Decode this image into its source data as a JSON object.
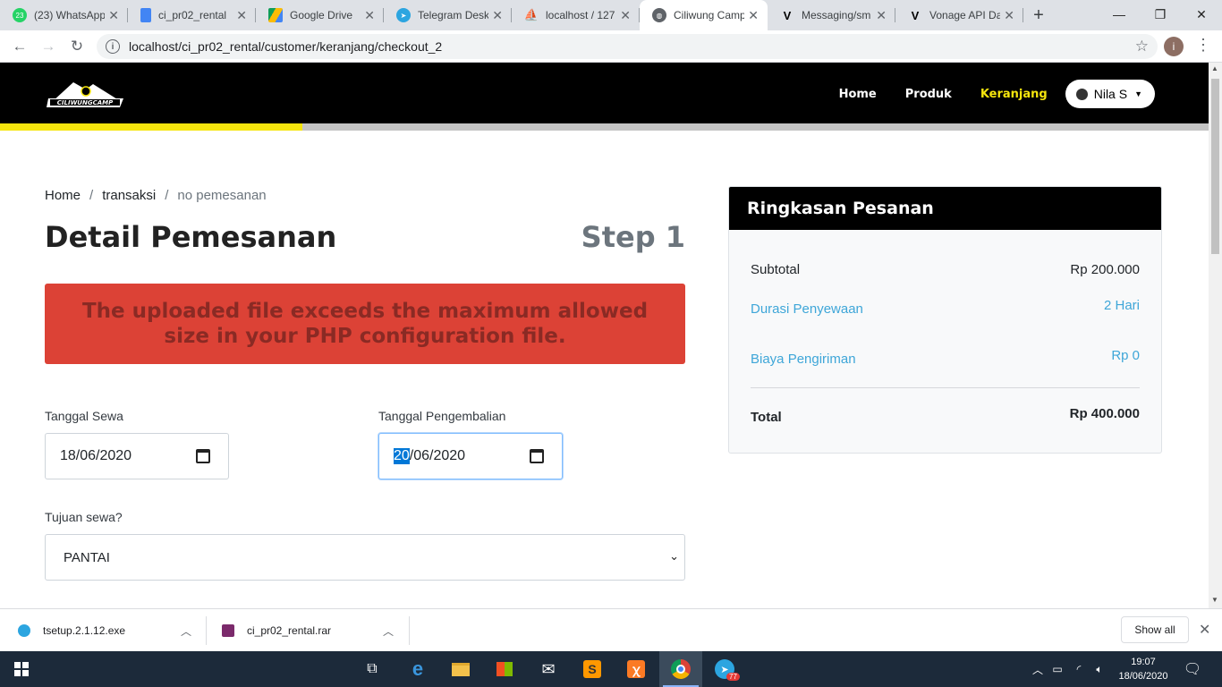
{
  "browser": {
    "tabs": [
      {
        "title": "(23) WhatsApp",
        "badge": "23",
        "favicon": "whatsapp-icon",
        "color": "#25d366"
      },
      {
        "title": "ci_pr02_rental",
        "favicon": "docs-icon",
        "color": "#4285f4"
      },
      {
        "title": "Google Drive",
        "favicon": "drive-icon",
        "color": "#fbbc04"
      },
      {
        "title": "Telegram Desk",
        "favicon": "telegram-icon",
        "color": "#2ca5e0"
      },
      {
        "title": "localhost / 127",
        "favicon": "phpmyadmin-icon",
        "color": "#f89c0e"
      },
      {
        "title": "Ciliwung Camp",
        "favicon": "globe-icon",
        "color": "#5f6368",
        "active": true
      },
      {
        "title": "Messaging/sm",
        "favicon": "vonage-icon",
        "color": "#000000"
      },
      {
        "title": "Vonage API Da",
        "favicon": "vonage-icon",
        "color": "#000000"
      }
    ],
    "url": "localhost/ci_pr02_rental/customer/keranjang/checkout_2",
    "profile_initial": "i"
  },
  "site": {
    "brand": "CILIWUNGCAMP",
    "nav": {
      "home": "Home",
      "produk": "Produk",
      "keranjang": "Keranjang"
    },
    "user": "Nila S",
    "progress_fraction": 0.25
  },
  "page": {
    "breadcrumb": [
      "Home",
      "transaksi",
      "no pemesanan"
    ],
    "breadcrumb_sep": "/",
    "title": "Detail Pemesanan",
    "step": "Step 1",
    "alert": "The uploaded file exceeds the maximum allowed size in your PHP configuration file."
  },
  "form": {
    "start_label": "Tanggal Sewa",
    "start_date": "18/06/2020",
    "end_label": "Tanggal Pengembalian",
    "end_day": "20",
    "end_rest": "/06/2020",
    "purpose_label": "Tujuan sewa?",
    "purpose_value": "PANTAI"
  },
  "summary": {
    "title": "Ringkasan Pesanan",
    "subtotal_label": "Subtotal",
    "subtotal_value": "Rp 200.000",
    "duration_label": "Durasi Penyewaan",
    "duration_value": "2 Hari",
    "shipping_label": "Biaya Pengiriman",
    "shipping_value": "Rp 0",
    "total_label": "Total",
    "total_value": "Rp 400.000"
  },
  "downloads": {
    "items": [
      "tsetup.2.1.12.exe",
      "ci_pr02_rental.rar"
    ],
    "show_all": "Show all"
  },
  "taskbar": {
    "time": "19:07",
    "date": "18/06/2020",
    "telegram_badge": "77"
  },
  "colors": {
    "accent_yellow": "#f5e50d",
    "alert_red": "#dc4236",
    "summary_blue": "#3ea6d8"
  }
}
